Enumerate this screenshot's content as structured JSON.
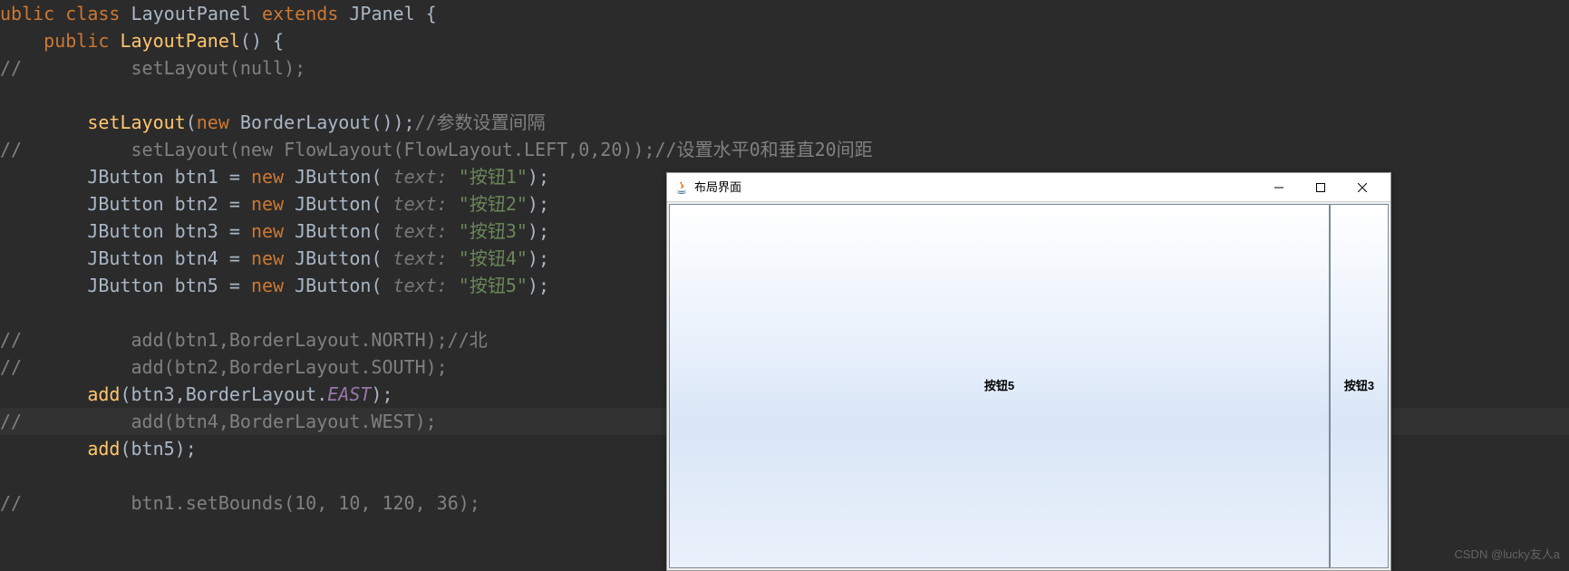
{
  "code": {
    "l1": {
      "pre": "",
      "t": "ublic class LayoutPanel extends JPanel {"
    },
    "l2": {
      "pre": "    ",
      "t": "public LayoutPanel() {"
    },
    "l3": {
      "pre": "//          ",
      "t": "setLayout(null);"
    },
    "l4": {
      "pre": "",
      "t": ""
    },
    "l5": {
      "pre": "        ",
      "t": "setLayout(new BorderLayout());",
      "c": "//参数设置间隔"
    },
    "l6": {
      "pre": "//          ",
      "t": "setLayout(new FlowLayout(FlowLayout.LEFT,0,20));//设置水平0和垂直20间距"
    },
    "l7": {
      "pre": "        ",
      "var": "btn1",
      "str": "\"按钮1\""
    },
    "l8": {
      "pre": "        ",
      "var": "btn2",
      "str": "\"按钮2\""
    },
    "l9": {
      "pre": "        ",
      "var": "btn3",
      "str": "\"按钮3\""
    },
    "l10": {
      "pre": "        ",
      "var": "btn4",
      "str": "\"按钮4\""
    },
    "l11": {
      "pre": "        ",
      "var": "btn5",
      "str": "\"按钮5\""
    },
    "l12": {
      "pre": "",
      "t": ""
    },
    "l13": {
      "pre": "//          ",
      "t": "add(btn1,BorderLayout.NORTH);//北"
    },
    "l14": {
      "pre": "//          ",
      "t": "add(btn2,BorderLayout.SOUTH);"
    },
    "l15": {
      "pre": "        ",
      "t": "add(btn3,BorderLayout.",
      "field": "EAST",
      "end": ");"
    },
    "l16": {
      "pre": "//          ",
      "t": "add(btn4,BorderLayout.WEST);"
    },
    "l17": {
      "pre": "        ",
      "t": "add(btn5);"
    },
    "l18": {
      "pre": "",
      "t": ""
    },
    "l19": {
      "pre": "//          ",
      "t": "btn1.setBounds(10, 10, 120, 36);"
    },
    "hint": "text: ",
    "kw_public": "public",
    "kw_class": "class",
    "kw_extends": "extends",
    "kw_new": "new",
    "jbutton": "JButton",
    "cls_layoutpanel": "LayoutPanel",
    "cls_jpanel": "JPanel",
    "cls_borderlayout": "BorderLayout",
    "m_setlayout": "setLayout",
    "m_layoutpanel": "LayoutPanel",
    "m_add": "add"
  },
  "window": {
    "title": "布局界面",
    "btn5": "按钮5",
    "btn3": "按钮3"
  },
  "watermark": "CSDN @lucky友人a"
}
